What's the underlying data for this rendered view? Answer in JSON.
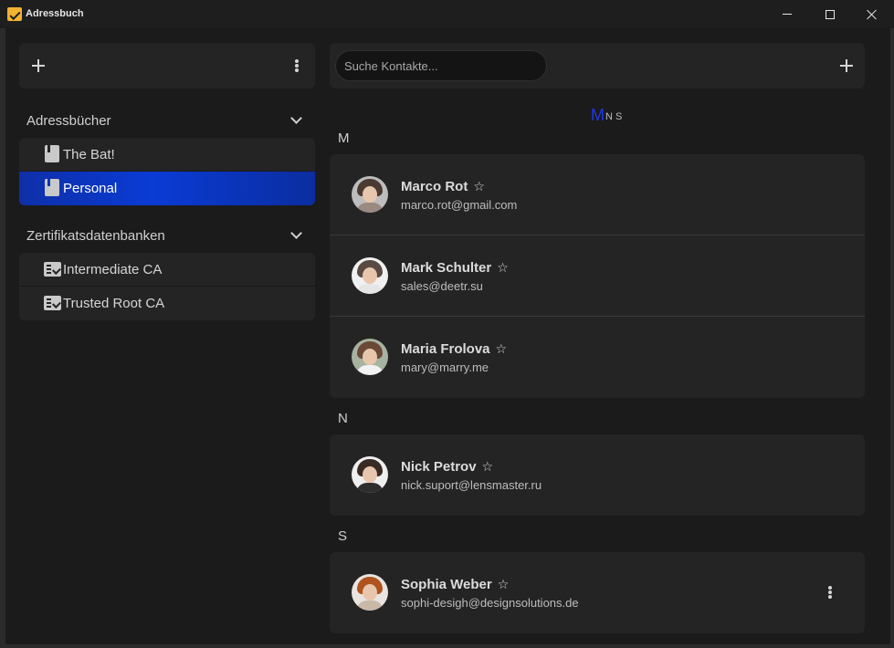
{
  "window": {
    "title": "Adressbuch"
  },
  "sidebar": {
    "sections": [
      {
        "title": "Adressbücher",
        "items": [
          {
            "label": "The Bat!",
            "icon": "book-icon",
            "active": false
          },
          {
            "label": "Personal",
            "icon": "book-icon",
            "active": true
          }
        ]
      },
      {
        "title": "Zertifikatsdatenbanken",
        "items": [
          {
            "label": "Intermediate CA",
            "icon": "certificate-icon",
            "active": false
          },
          {
            "label": "Trusted Root CA",
            "icon": "certificate-icon",
            "active": false
          }
        ]
      }
    ]
  },
  "search": {
    "placeholder": "Suche Kontakte..."
  },
  "alphabet": {
    "letters": [
      "M",
      "N",
      "S"
    ],
    "current": "M"
  },
  "groups": [
    {
      "letter": "M",
      "contacts": [
        {
          "name": "Marco Rot",
          "email": "marco.rot@gmail.com",
          "favorite_icon": "star-outline-icon"
        },
        {
          "name": "Mark Schulter",
          "email": "sales@deetr.su",
          "favorite_icon": "star-outline-icon"
        },
        {
          "name": "Maria Frolova",
          "email": "mary@marry.me",
          "favorite_icon": "star-outline-icon"
        }
      ]
    },
    {
      "letter": "N",
      "contacts": [
        {
          "name": "Nick Petrov",
          "email": "nick.suport@lensmaster.ru",
          "favorite_icon": "star-outline-icon"
        }
      ]
    },
    {
      "letter": "S",
      "contacts": [
        {
          "name": "Sophia Weber",
          "email": "sophi-desigh@designsolutions.de",
          "favorite_icon": "star-outline-icon"
        }
      ]
    }
  ],
  "colors": {
    "background": "#1b1b1b",
    "card": "#242424",
    "accent": "#0a3bd4",
    "alphabet_current": "#1f37e8",
    "app_icon": "#f2b230"
  }
}
